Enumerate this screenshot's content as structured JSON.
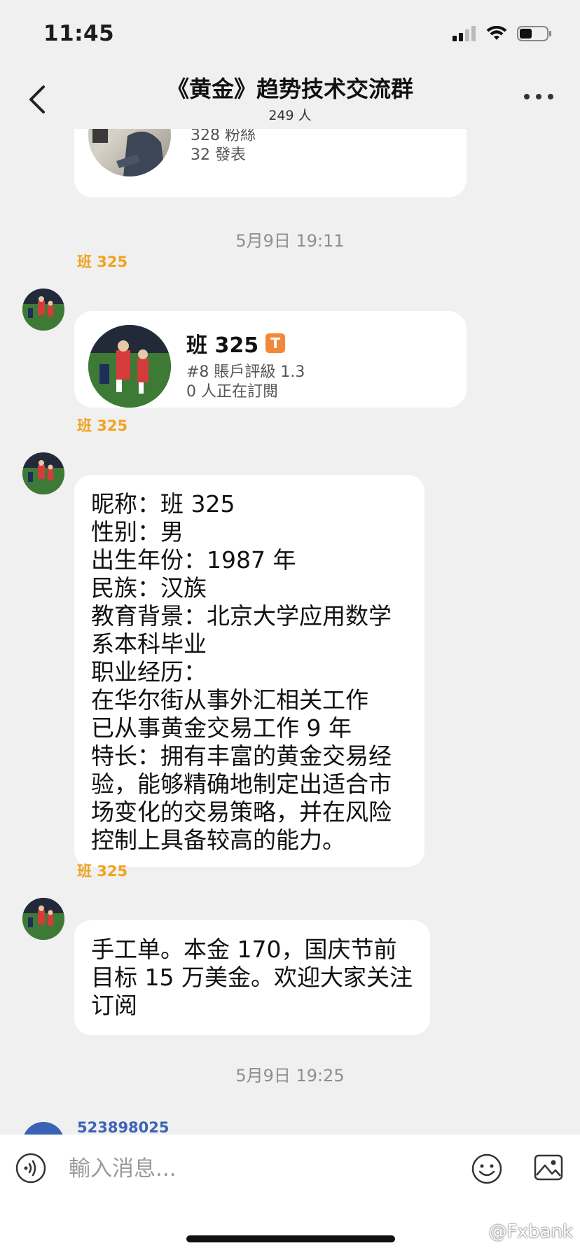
{
  "status_bar": {
    "time": "11:45",
    "battery_level": 0.45
  },
  "header": {
    "title": "《黄金》趋势技术交流群",
    "member_count": "249 人"
  },
  "messages": {
    "top_card": {
      "fans": "328 粉絲",
      "posts": "32 發表"
    },
    "time_1": "5月9日 19:11",
    "msg1": {
      "sender": "班 325",
      "card_name": "班 325",
      "badge": "T",
      "rank": "#8 賬戶評級 1.3",
      "subscribers": "0 人正在訂閱"
    },
    "msg2": {
      "sender": "班 325",
      "lines": [
        "昵称：班 325",
        "性别：男",
        "出生年份：1987 年",
        "民族：汉族",
        "教育背景：北京大学应用数学",
        "系本科毕业",
        "职业经历：",
        "在华尔街从事外汇相关工作",
        "已从事黄金交易工作 9 年",
        "特长：拥有丰富的黄金交易经",
        "验，能够精确地制定出适合市",
        "场变化的交易策略，并在风险",
        "控制上具备较高的能力。"
      ]
    },
    "msg3": {
      "sender": "班 325",
      "lines": [
        "手工单。本金 170，国庆节前",
        "目标 15 万美金。欢迎大家关注",
        "订阅"
      ]
    },
    "time_2": "5月9日 19:25",
    "msg4": {
      "sender": "523898025"
    }
  },
  "input": {
    "placeholder": "輸入消息..."
  },
  "watermark": "@Fxbank",
  "colors": {
    "background": "#f0f0f0",
    "sender_name": "#f0a321",
    "badge": "#f08a3a",
    "link_blue": "#3b63b5"
  }
}
